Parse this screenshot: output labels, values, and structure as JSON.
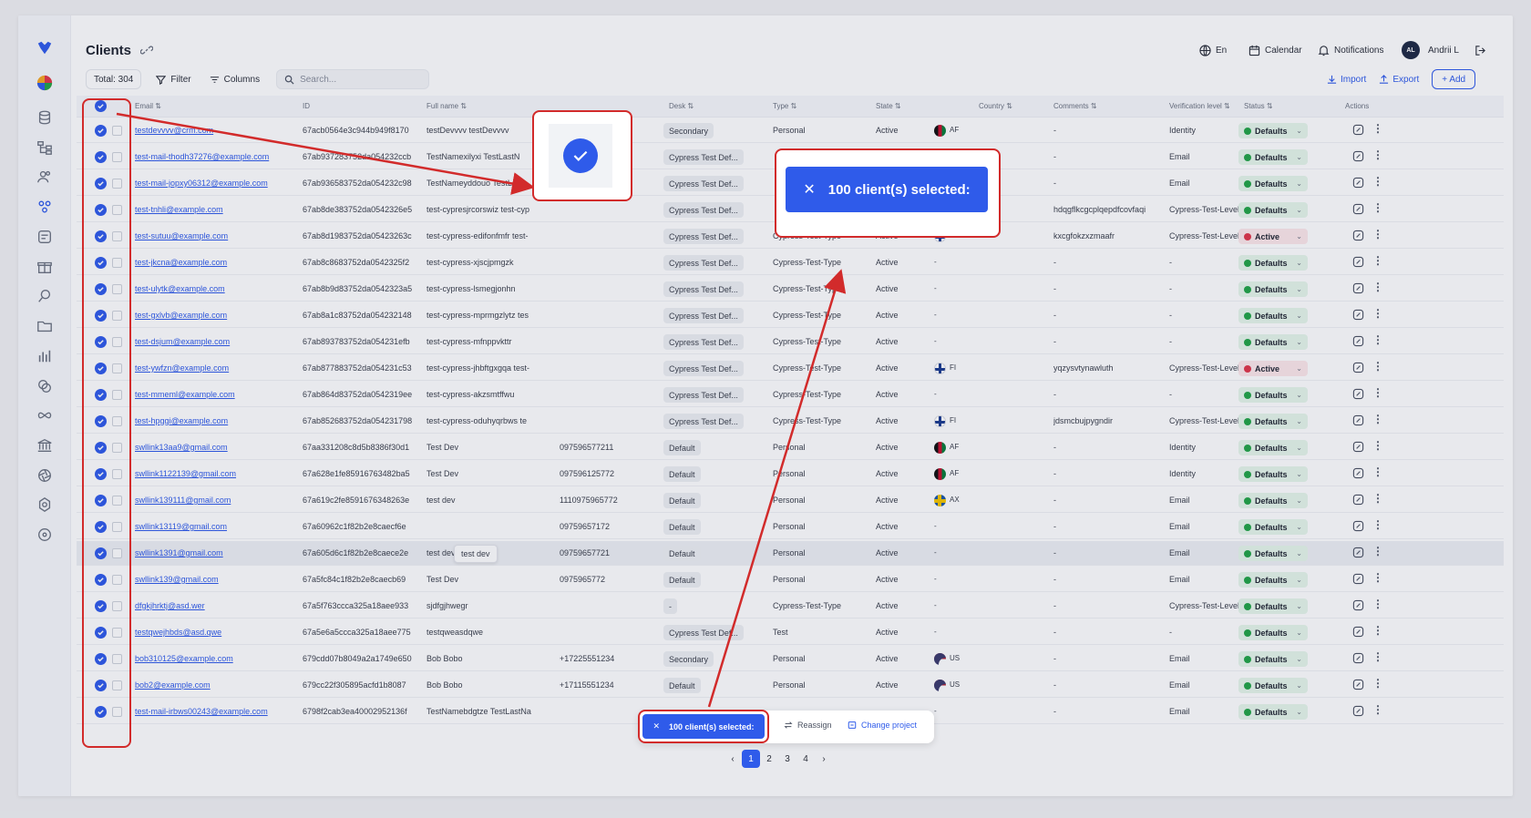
{
  "header": {
    "title": "Clients",
    "language": "En",
    "calendar": "Calendar",
    "notifications": "Notifications",
    "avatar_initials": "AL",
    "user_name": "Andrii L"
  },
  "toolbar": {
    "total": "Total: 304",
    "filter": "Filter",
    "columns": "Columns",
    "search_placeholder": "Search...",
    "import": "Import",
    "export": "Export",
    "add": "+ Add"
  },
  "columns": [
    "Email",
    "ID",
    "Full name",
    "Desk",
    "Type",
    "State",
    "Country",
    "Comments",
    "Verification level",
    "Status",
    "Actions"
  ],
  "rows": [
    {
      "email": "testdevvvv@crm.com",
      "id": "67acb0564e3c944b949f8170",
      "name": "testDevvvv testDevvvv",
      "phone": "",
      "desk": "Secondary",
      "type": "Personal",
      "state": "Active",
      "flag": "AF",
      "country": "AF",
      "comments": "-",
      "verif": "Identity",
      "status": "Defaults",
      "statusColor": "green"
    },
    {
      "email": "test-mail-thodh37276@example.com",
      "id": "67ab937283752da054232ccb",
      "name": "TestNamexilyxi TestLastN",
      "phone": "",
      "desk": "Cypress Test Def...",
      "type": "",
      "state": "",
      "flag": "",
      "country": "",
      "comments": "-",
      "verif": "Email",
      "status": "Defaults",
      "statusColor": "green"
    },
    {
      "email": "test-mail-jopxy06312@example.com",
      "id": "67ab936583752da054232c98",
      "name": "TestNameyddouo TestLas",
      "phone": "",
      "desk": "Cypress Test Def...",
      "type": "",
      "state": "",
      "flag": "",
      "country": "",
      "comments": "-",
      "verif": "Email",
      "status": "Defaults",
      "statusColor": "green"
    },
    {
      "email": "test-tnhli@example.com",
      "id": "67ab8de383752da0542326e5",
      "name": "test-cypresjrcorswiz test-cyp",
      "phone": "",
      "desk": "Cypress Test Def...",
      "type": "",
      "state": "",
      "flag": "FI",
      "country": "FI",
      "comments": "hdqgflkcgcplqepdfcovfaqi",
      "verif": "Cypress-Test-Level",
      "status": "Defaults",
      "statusColor": "green"
    },
    {
      "email": "test-sutuu@example.com",
      "id": "67ab8d1983752da05423263c",
      "name": "test-cypress-edifonfmfr test-",
      "phone": "",
      "desk": "Cypress Test Def...",
      "type": "Cypress-Test-Type",
      "state": "Active",
      "flag": "FI",
      "country": "FI",
      "comments": "kxcgfokzxzmaafr",
      "verif": "Cypress-Test-Level",
      "status": "Active",
      "statusColor": "red"
    },
    {
      "email": "test-jkcna@example.com",
      "id": "67ab8c8683752da0542325f2",
      "name": "test-cypress-xjscjpmgzk",
      "phone": "",
      "desk": "Cypress Test Def...",
      "type": "Cypress-Test-Type",
      "state": "Active",
      "flag": "",
      "country": "-",
      "comments": "-",
      "verif": "-",
      "status": "Defaults",
      "statusColor": "green"
    },
    {
      "email": "test-ulytk@example.com",
      "id": "67ab8b9d83752da0542323a5",
      "name": "test-cypress-lsmegjonhn",
      "phone": "",
      "desk": "Cypress Test Def...",
      "type": "Cypress-Test-Type",
      "state": "Active",
      "flag": "",
      "country": "-",
      "comments": "-",
      "verif": "-",
      "status": "Defaults",
      "statusColor": "green"
    },
    {
      "email": "test-gxlvb@example.com",
      "id": "67ab8a1c83752da054232148",
      "name": "test-cypress-mprmgzlytz tes",
      "phone": "",
      "desk": "Cypress Test Def...",
      "type": "Cypress-Test-Type",
      "state": "Active",
      "flag": "",
      "country": "-",
      "comments": "-",
      "verif": "-",
      "status": "Defaults",
      "statusColor": "green"
    },
    {
      "email": "test-dsjum@example.com",
      "id": "67ab893783752da054231efb",
      "name": "test-cypress-mfnppvkttr",
      "phone": "",
      "desk": "Cypress Test Def...",
      "type": "Cypress-Test-Type",
      "state": "Active",
      "flag": "",
      "country": "-",
      "comments": "-",
      "verif": "-",
      "status": "Defaults",
      "statusColor": "green"
    },
    {
      "email": "test-ywfzn@example.com",
      "id": "67ab877883752da054231c53",
      "name": "test-cypress-jhbftgxgqa test-",
      "phone": "",
      "desk": "Cypress Test Def...",
      "type": "Cypress-Test-Type",
      "state": "Active",
      "flag": "FI",
      "country": "FI",
      "comments": "yqzysvtynawluth",
      "verif": "Cypress-Test-Level",
      "status": "Active",
      "statusColor": "red"
    },
    {
      "email": "test-mmeml@example.com",
      "id": "67ab864d83752da0542319ee",
      "name": "test-cypress-akzsmtffwu",
      "phone": "",
      "desk": "Cypress Test Def...",
      "type": "Cypress-Test-Type",
      "state": "Active",
      "flag": "",
      "country": "-",
      "comments": "-",
      "verif": "-",
      "status": "Defaults",
      "statusColor": "green"
    },
    {
      "email": "test-hpggi@example.com",
      "id": "67ab852683752da054231798",
      "name": "test-cypress-oduhyqrbws te",
      "phone": "",
      "desk": "Cypress Test Def...",
      "type": "Cypress-Test-Type",
      "state": "Active",
      "flag": "FI",
      "country": "FI",
      "comments": "jdsmcbujpygndir",
      "verif": "Cypress-Test-Level",
      "status": "Defaults",
      "statusColor": "green"
    },
    {
      "email": "swllink13aa9@gmail.com",
      "id": "67aa331208c8d5b8386f30d1",
      "name": "Test Dev",
      "phone": "097596577211",
      "desk": "Default",
      "type": "Personal",
      "state": "Active",
      "flag": "AF",
      "country": "AF",
      "comments": "-",
      "verif": "Identity",
      "status": "Defaults",
      "statusColor": "green"
    },
    {
      "email": "swllink1122139@gmail.com",
      "id": "67a628e1fe85916763482ba5",
      "name": "Test Dev",
      "phone": "097596125772",
      "desk": "Default",
      "type": "Personal",
      "state": "Active",
      "flag": "AF",
      "country": "AF",
      "comments": "-",
      "verif": "Identity",
      "status": "Defaults",
      "statusColor": "green"
    },
    {
      "email": "swllink139111@gmail.com",
      "id": "67a619c2fe8591676348263e",
      "name": "test dev",
      "phone": "1110975965772",
      "desk": "Default",
      "type": "Personal",
      "state": "Active",
      "flag": "AX",
      "country": "AX",
      "comments": "-",
      "verif": "Email",
      "status": "Defaults",
      "statusColor": "green"
    },
    {
      "email": "swllink13119@gmail.com",
      "id": "67a60962c1f82b2e8caecf6e",
      "name": "",
      "phone": "09759657172",
      "desk": "Default",
      "type": "Personal",
      "state": "Active",
      "flag": "",
      "country": "-",
      "comments": "-",
      "verif": "Email",
      "status": "Defaults",
      "statusColor": "green"
    },
    {
      "email": "swllink1391@gmail.com",
      "id": "67a605d6c1f82b2e8caece2e",
      "name": "test dev",
      "phone": "09759657721",
      "desk": "Default",
      "type": "Personal",
      "state": "Active",
      "flag": "",
      "country": "-",
      "comments": "-",
      "verif": "Email",
      "status": "Defaults",
      "statusColor": "green"
    },
    {
      "email": "swllink139@gmail.com",
      "id": "67a5fc84c1f82b2e8caecb69",
      "name": "Test Dev",
      "phone": "0975965772",
      "desk": "Default",
      "type": "Personal",
      "state": "Active",
      "flag": "",
      "country": "-",
      "comments": "-",
      "verif": "Email",
      "status": "Defaults",
      "statusColor": "green"
    },
    {
      "email": "dfgkjhrktj@asd.wer",
      "id": "67a5f763ccca325a18aee933",
      "name": "sjdfgjhwegr",
      "phone": "",
      "desk": "-",
      "type": "Cypress-Test-Type",
      "state": "Active",
      "flag": "",
      "country": "-",
      "comments": "-",
      "verif": "Cypress-Test-Level",
      "status": "Defaults",
      "statusColor": "green"
    },
    {
      "email": "testqwejhbds@asd.qwe",
      "id": "67a5e6a5ccca325a18aee775",
      "name": "testqweasdqwe",
      "phone": "",
      "desk": "Cypress Test Def...",
      "type": "Test",
      "state": "Active",
      "flag": "",
      "country": "-",
      "comments": "-",
      "verif": "-",
      "status": "Defaults",
      "statusColor": "green"
    },
    {
      "email": "bob310125@example.com",
      "id": "679cdd07b8049a2a1749e650",
      "name": "Bob Bobo",
      "phone": "+17225551234",
      "desk": "Secondary",
      "type": "Personal",
      "state": "Active",
      "flag": "US",
      "country": "US",
      "comments": "-",
      "verif": "Email",
      "status": "Defaults",
      "statusColor": "green"
    },
    {
      "email": "bob2@example.com",
      "id": "679cc22f305895acfd1b8087",
      "name": "Bob Bobo",
      "phone": "+17115551234",
      "desk": "Default",
      "type": "Personal",
      "state": "Active",
      "flag": "US",
      "country": "US",
      "comments": "-",
      "verif": "Email",
      "status": "Defaults",
      "statusColor": "green"
    },
    {
      "email": "test-mail-irbws00243@example.com",
      "id": "6798f2cab3ea40002952136f",
      "name": "TestNamebdgtze TestLastNa",
      "phone": "",
      "desk": "",
      "type": "",
      "state": "",
      "flag": "",
      "country": "-",
      "comments": "-",
      "verif": "Email",
      "status": "Defaults",
      "statusColor": "green"
    }
  ],
  "tooltip": "test dev",
  "selection": {
    "big_label": "100 client(s) selected:",
    "small_label": "100 client(s) selected:",
    "reassign": "Reassign",
    "change_project": "Change project"
  },
  "pagination": [
    "1",
    "2",
    "3",
    "4"
  ],
  "colors": {
    "accent": "#2f5bea",
    "highlight": "#d22b2b",
    "status_green": "#22a447",
    "status_red": "#e0364a"
  }
}
